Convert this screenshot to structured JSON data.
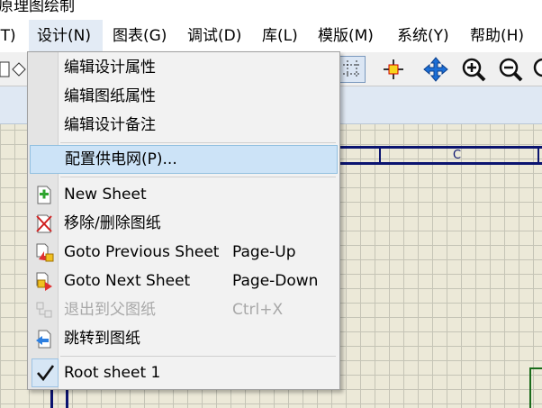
{
  "window": {
    "title": "原理图绘制"
  },
  "menubar": {
    "items": [
      {
        "label": "(T)"
      },
      {
        "label": "设计(N)",
        "active": true
      },
      {
        "label": "图表(G)"
      },
      {
        "label": "调试(D)"
      },
      {
        "label": "库(L)"
      },
      {
        "label": "模版(M)"
      },
      {
        "label": "系统(Y)"
      },
      {
        "label": "帮助(H)"
      }
    ]
  },
  "toolbar": {
    "icons": [
      "component-icon",
      "grid-icon",
      "origin-icon",
      "pan-icon",
      "zoom-in-icon",
      "zoom-out-icon",
      "zoom-all-icon"
    ]
  },
  "canvas": {
    "zone_label": "C"
  },
  "design_menu": {
    "items": [
      {
        "label": "编辑设计属性",
        "shortcut": ""
      },
      {
        "label": "编辑图纸属性",
        "shortcut": ""
      },
      {
        "label": "编辑设计备注",
        "shortcut": ""
      },
      {
        "label": "配置供电网(P)...",
        "shortcut": "",
        "highlighted": true
      },
      {
        "label": "New Sheet",
        "shortcut": "",
        "icon": "new-sheet-icon"
      },
      {
        "label": "移除/删除图纸",
        "shortcut": "",
        "icon": "remove-sheet-icon"
      },
      {
        "label": "Goto Previous Sheet",
        "shortcut": "Page-Up",
        "icon": "previous-sheet-icon"
      },
      {
        "label": "Goto Next Sheet",
        "shortcut": "Page-Down",
        "icon": "next-sheet-icon"
      },
      {
        "label": "退出到父图纸",
        "shortcut": "Ctrl+X",
        "icon": "exit-to-parent-icon",
        "disabled": true
      },
      {
        "label": "跳转到图纸",
        "shortcut": "",
        "icon": "goto-sheet-icon"
      },
      {
        "label": "Root sheet 1",
        "shortcut": "",
        "icon": "checkmark-icon",
        "checked": true
      }
    ]
  },
  "colors": {
    "menu_highlight": "#cce3f7",
    "sheet_border": "#0b1470",
    "canvas_bg": "#ece9d8"
  }
}
